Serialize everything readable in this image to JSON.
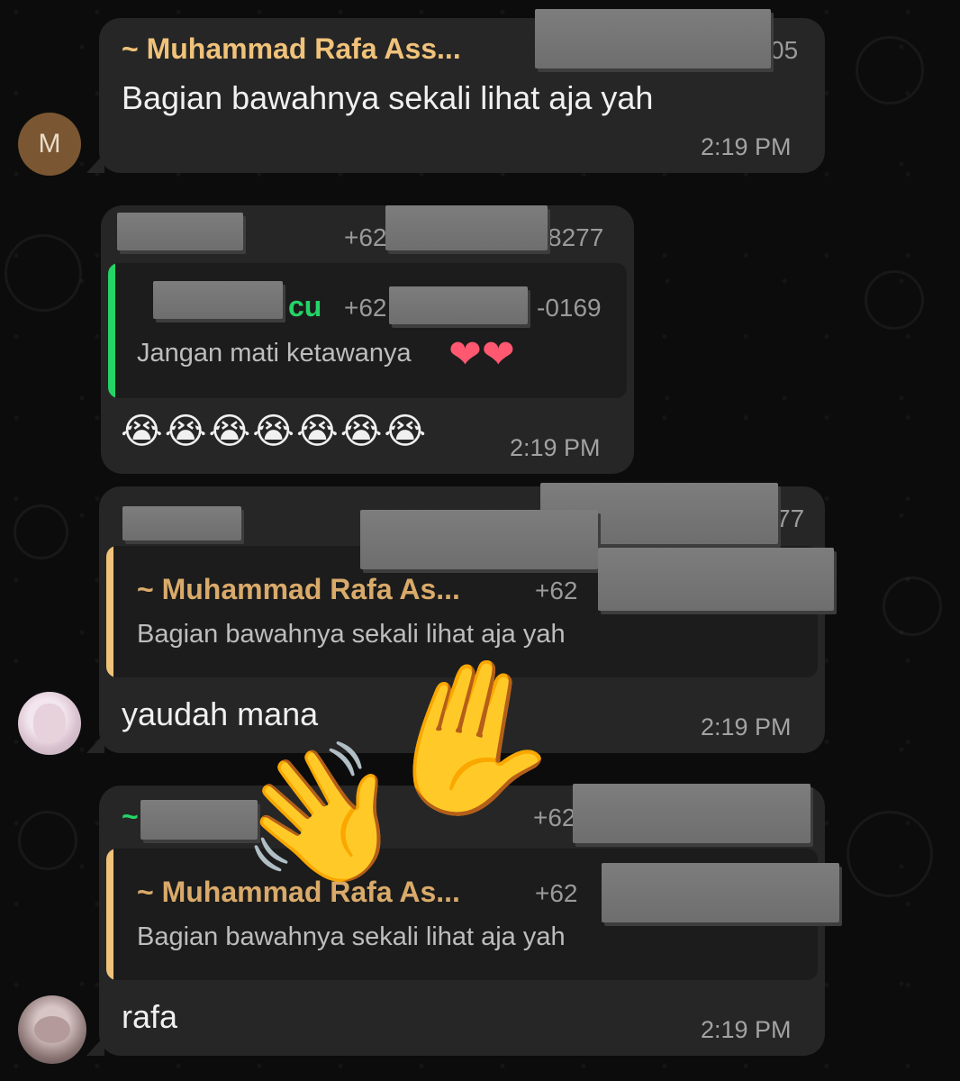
{
  "messages": [
    {
      "sender": "~ Muhammad Rafa Ass...",
      "phone_tail": "05",
      "text": "Bagian bawahnya sekali lihat aja yah",
      "time": "2:19 PM",
      "avatar_letter": "M"
    },
    {
      "phone_prefix": "+62",
      "phone_tail": "8277",
      "quote": {
        "name_tail": "cu",
        "phone_prefix": "+62",
        "phone_tail": "-0169",
        "text": "Jangan mati ketawanya"
      },
      "text": "😭😭😭😭😭😭😭",
      "time": "2:19 PM"
    },
    {
      "phone_tail": "77",
      "quote": {
        "name": "~ Muhammad Rafa As...",
        "phone_prefix": "+62",
        "text": "Bagian bawahnya sekali lihat aja yah"
      },
      "text": "yaudah mana",
      "time": "2:19 PM"
    },
    {
      "name_tilde": "~",
      "phone_prefix": "+62",
      "quote": {
        "name": "~ Muhammad Rafa As...",
        "phone_prefix": "+62",
        "text": "Bagian bawahnya sekali lihat aja yah"
      },
      "text": "rafa",
      "time": "2:19 PM"
    }
  ],
  "stickers": {
    "hearts": "❤❤",
    "waving_hand": "👋",
    "raised_hand": "✋"
  },
  "colors": {
    "bubble": "#262626",
    "background": "#0b0b0b",
    "sender_name": "#f0c27a",
    "quote_bar_green": "#25d366",
    "quote_bar_yellow": "#f0c27a"
  }
}
